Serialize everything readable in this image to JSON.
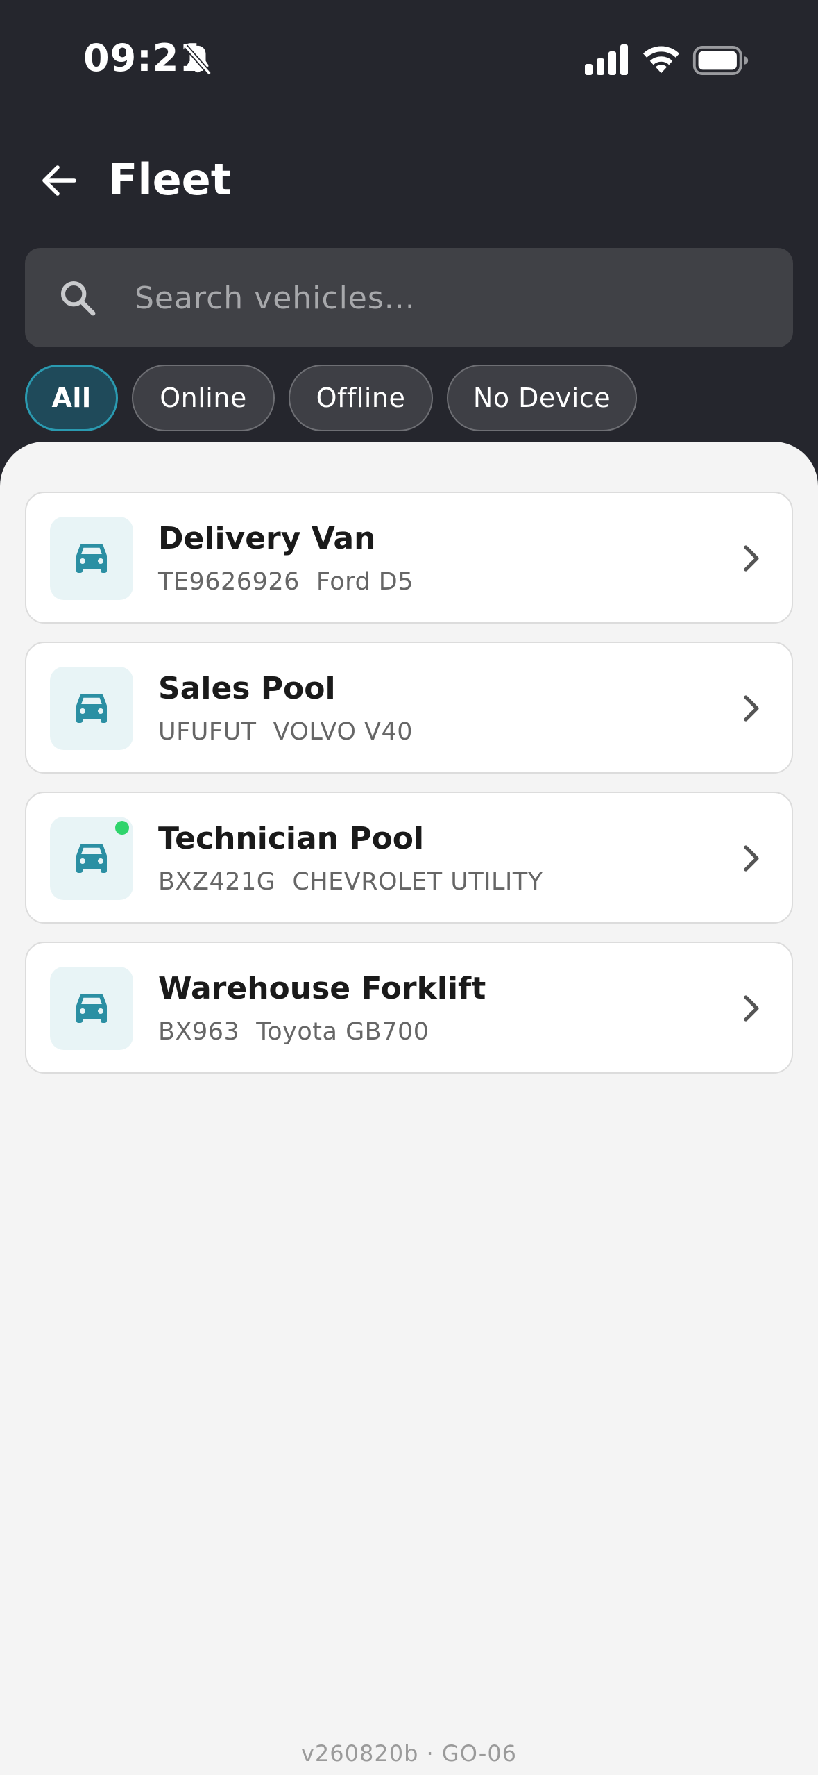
{
  "status_bar": {
    "time": "09:21",
    "icons": [
      "bell-off-icon",
      "signal-icon",
      "wifi-icon",
      "battery-icon"
    ]
  },
  "header": {
    "title": "Fleet",
    "back_icon": "arrow-left-icon"
  },
  "search": {
    "placeholder": "Search vehicles...",
    "value": "",
    "icon": "search-icon"
  },
  "filters": {
    "selected": "All",
    "items": [
      {
        "label": "All"
      },
      {
        "label": "Online"
      },
      {
        "label": "Offline"
      },
      {
        "label": "No Device"
      }
    ]
  },
  "vehicles": [
    {
      "name": "Delivery Van",
      "plate": "TE9626926",
      "model": "Ford D5",
      "online": false
    },
    {
      "name": "Sales Pool",
      "plate": "UFUFUT",
      "model": "VOLVO V40",
      "online": false
    },
    {
      "name": "Technician Pool",
      "plate": "BXZ421G",
      "model": "CHEVROLET UTILITY",
      "online": true
    },
    {
      "name": "Warehouse Forklift",
      "plate": "BX963",
      "model": "Toyota GB700",
      "online": false
    }
  ],
  "footer": {
    "version": "v260820b · GO-06"
  },
  "colors": {
    "header_bg": "#25262d",
    "accent": "#2a9ab0",
    "icon_teal": "#2b8fa3",
    "online": "#2fd46c",
    "background": "#f4f4f4"
  }
}
